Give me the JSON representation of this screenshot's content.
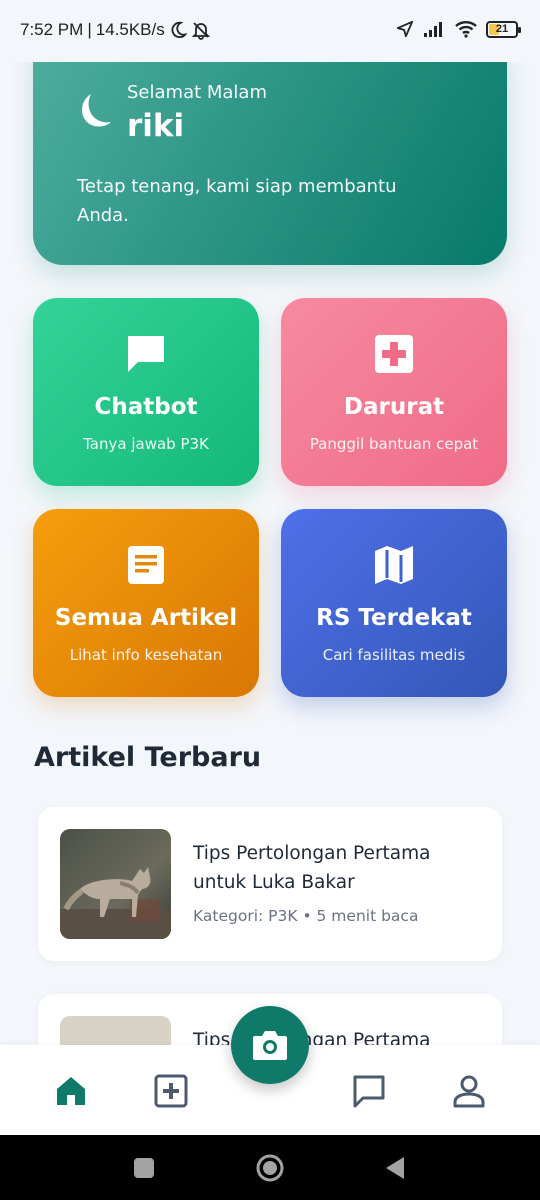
{
  "status_bar": {
    "time": "7:52 PM",
    "separator": "|",
    "speed": "14.5KB/s",
    "battery": "21"
  },
  "greeting": {
    "subtitle": "Selamat Malam",
    "name": "riki",
    "message": "Tetap tenang, kami siap membantu Anda."
  },
  "menu": [
    {
      "title": "Chatbot",
      "desc": "Tanya jawab P3K",
      "icon": "chat-bubble-icon",
      "color": "#14b879"
    },
    {
      "title": "Darurat",
      "desc": "Panggil bantuan cepat",
      "icon": "medical-cross-icon",
      "color": "#f06b87"
    },
    {
      "title": "Semua Artikel",
      "desc": "Lihat info kesehatan",
      "icon": "article-icon",
      "color": "#d97706"
    },
    {
      "title": "RS Terdekat",
      "desc": "Cari fasilitas medis",
      "icon": "map-icon",
      "color": "#3357b8"
    }
  ],
  "section_title": "Artikel Terbaru",
  "articles": [
    {
      "title": "Tips Pertolongan Pertama untuk Luka Bakar",
      "meta": "Kategori: P3K • 5 menit baca"
    },
    {
      "title": "Tips Pertolongan Pertama",
      "meta": ""
    }
  ],
  "nav": [
    "home-icon",
    "health-icon",
    "camera-icon",
    "chat-icon",
    "profile-icon"
  ],
  "colors": {
    "primary": "#0f7a69",
    "nav_inactive": "#4b5a6e"
  }
}
